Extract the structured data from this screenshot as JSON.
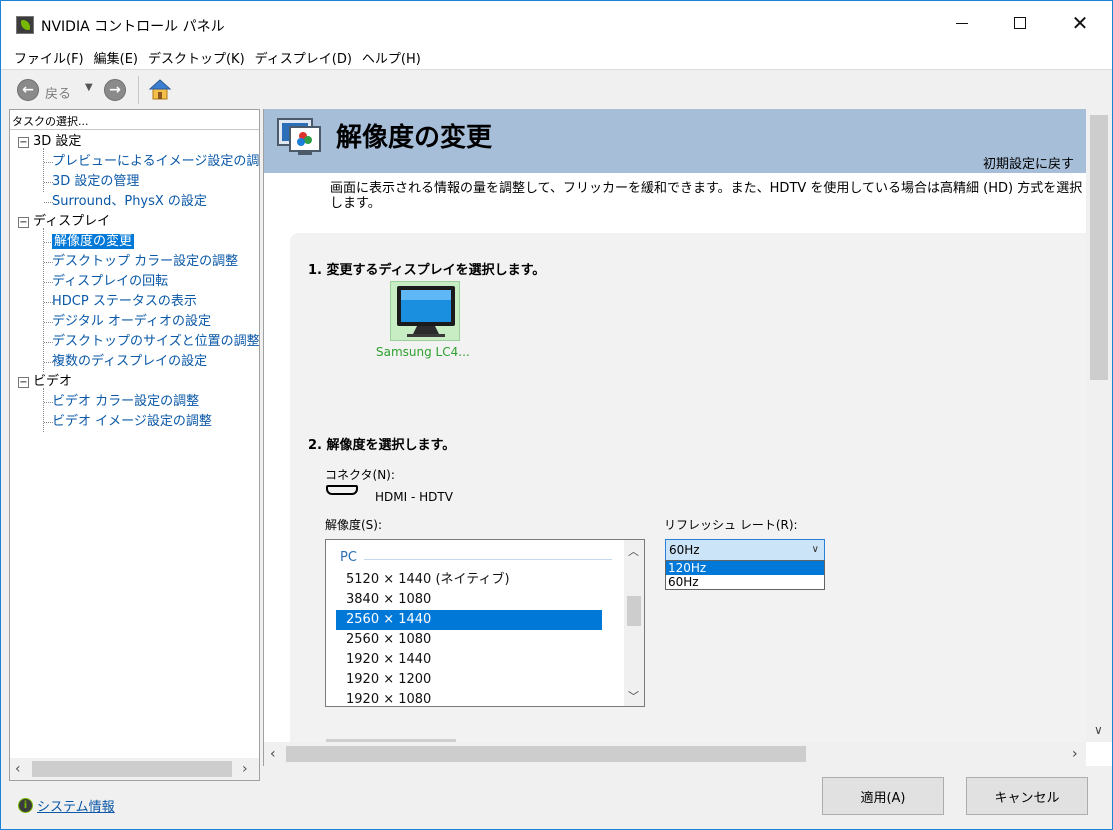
{
  "window": {
    "title": "NVIDIA コントロール パネル"
  },
  "menubar": {
    "items": [
      "ファイル(F)",
      "編集(E)",
      "デスクトップ(K)",
      "ディスプレイ(D)",
      "ヘルプ(H)"
    ]
  },
  "toolbar": {
    "back_label": "戻る"
  },
  "sidebar": {
    "header": "タスクの選択...",
    "categories": [
      {
        "label": "3D 設定",
        "children": [
          "プレビューによるイメージ設定の調整",
          "3D 設定の管理",
          "Surround、PhysX の設定"
        ]
      },
      {
        "label": "ディスプレイ",
        "children": [
          "解像度の変更",
          "デスクトップ カラー設定の調整",
          "ディスプレイの回転",
          "HDCP ステータスの表示",
          "デジタル オーディオの設定",
          "デスクトップのサイズと位置の調整",
          "複数のディスプレイの設定"
        ]
      },
      {
        "label": "ビデオ",
        "children": [
          "ビデオ カラー設定の調整",
          "ビデオ イメージ設定の調整"
        ]
      }
    ],
    "selected": "解像度の変更",
    "system_info": "システム情報"
  },
  "page": {
    "title": "解像度の変更",
    "restore_defaults": "初期設定に戻す",
    "description": "画面に表示される情報の量を調整して、フリッカーを緩和できます。また、HDTV を使用している場合は高精細 (HD) 方式を選択します。",
    "step1": "1. 変更するディスプレイを選択します。",
    "display_name": "Samsung LC4...",
    "step2": "2. 解像度を選択します。",
    "connector_label": "コネクタ(N):",
    "connector_value": "HDMI - HDTV",
    "resolution_label": "解像度(S):",
    "resolution_group": "PC",
    "resolutions": [
      "5120 × 1440 (ネイティブ)",
      "3840 × 1080",
      "2560 × 1440",
      "2560 × 1080",
      "1920 × 1440",
      "1920 × 1200",
      "1920 × 1080"
    ],
    "selected_resolution": "2560 × 1440",
    "refresh_label": "リフレッシュ レート(R):",
    "refresh_value": "60Hz",
    "refresh_options": [
      "120Hz",
      "60Hz"
    ],
    "highlighted_option": "120Hz"
  },
  "buttons": {
    "apply": "適用(A)",
    "cancel": "キャンセル"
  },
  "colors": {
    "accent": "#0078d7",
    "header_band": "#a7bed9",
    "nvidia_green": "#76b900",
    "link": "#0a58a7"
  }
}
